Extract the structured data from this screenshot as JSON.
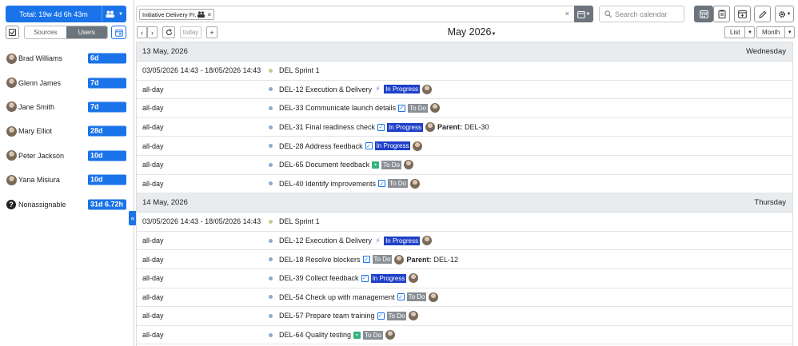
{
  "toolbar": {
    "total_label": "Total: 19w 4d 6h 43m",
    "sources_label": "Sources",
    "users_label": "Users",
    "filter_chip": "Initiative Delivery Fr.",
    "filter_chip_remove": "×",
    "filter_clear": "×",
    "search_placeholder": "Search calendar",
    "today_label": "today",
    "month_title": "May 2026",
    "view_label": "List",
    "range_label": "Month"
  },
  "users": [
    {
      "name": "Brad Williams",
      "total": "6d"
    },
    {
      "name": "Glenn James",
      "total": "7d"
    },
    {
      "name": "Jane Smith",
      "total": "7d"
    },
    {
      "name": "Mary Elliot",
      "total": "28d"
    },
    {
      "name": "Peter Jackson",
      "total": "10d"
    },
    {
      "name": "Yana Misiura",
      "total": "10d"
    },
    {
      "name": "Nonassignable",
      "total": "31d 6.72h"
    }
  ],
  "days": [
    {
      "date": "13 May, 2026",
      "weekday": "Wednesday",
      "events": [
        {
          "time": "03/05/2026 14:43 - 18/05/2026 14:43",
          "title": "DEL Sprint 1"
        },
        {
          "time": "all-day",
          "title": "DEL-12 Execution & Delivery",
          "status": "In Progress"
        },
        {
          "time": "all-day",
          "title": "DEL-33 Communicate launch details",
          "status": "To Do"
        },
        {
          "time": "all-day",
          "title": "DEL-31 Final readiness check",
          "status": "In Progress",
          "parent_label": "Parent:",
          "parent": "DEL-30"
        },
        {
          "time": "all-day",
          "title": "DEL-28 Address feedback",
          "status": "In Progress"
        },
        {
          "time": "all-day",
          "title": "DEL-65 Document feedback",
          "status": "To Do"
        },
        {
          "time": "all-day",
          "title": "DEL-40 Identify improvements",
          "status": "To Do"
        }
      ]
    },
    {
      "date": "14 May, 2026",
      "weekday": "Thursday",
      "events": [
        {
          "time": "03/05/2026 14:43 - 18/05/2026 14:43",
          "title": "DEL Sprint 1"
        },
        {
          "time": "all-day",
          "title": "DEL-12 Execution & Delivery",
          "status": "In Progress"
        },
        {
          "time": "all-day",
          "title": "DEL-18 Resolve blockers",
          "status": "To Do",
          "parent_label": "Parent:",
          "parent": "DEL-12"
        },
        {
          "time": "all-day",
          "title": "DEL-39 Collect feedback",
          "status": "In Progress"
        },
        {
          "time": "all-day",
          "title": "DEL-54 Check up with management",
          "status": "To Do"
        },
        {
          "time": "all-day",
          "title": "DEL-57 Prepare team training",
          "status": "To Do"
        },
        {
          "time": "all-day",
          "title": "DEL-64 Quality testing",
          "status": "To Do"
        }
      ]
    }
  ],
  "colors": {
    "primary": "#1a73e8",
    "in_progress": "#1e40c8",
    "to_do": "#8a8f95",
    "sprint_dot": "#c9c98a",
    "event_dot": "#8fa8d0"
  }
}
